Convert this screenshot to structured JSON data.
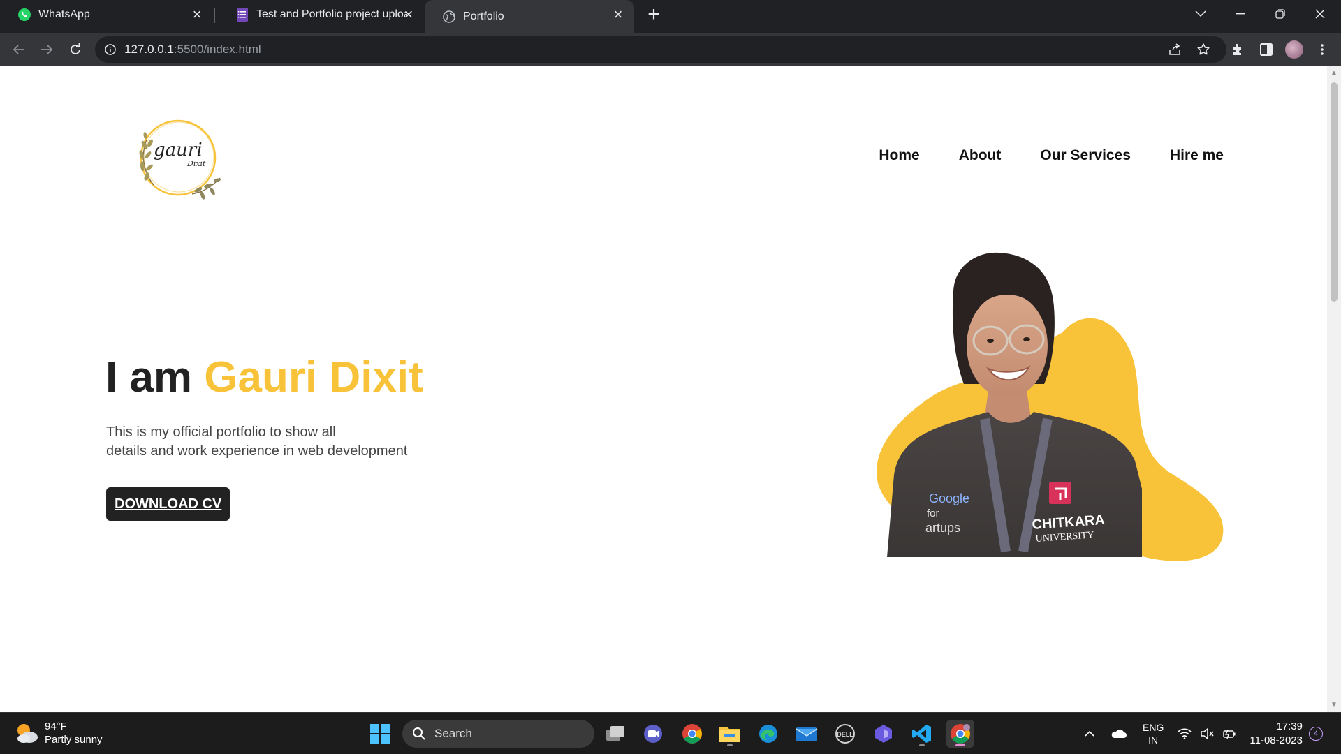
{
  "browser": {
    "tabs": [
      {
        "title": "WhatsApp",
        "icon": "whatsapp-icon"
      },
      {
        "title": "Test and Portfolio project upload",
        "icon": "forms-icon"
      },
      {
        "title": "Portfolio",
        "icon": "globe-icon"
      }
    ],
    "active_tab": 2,
    "url_host": "127.0.0.1",
    "url_path": ":5500/index.html"
  },
  "page": {
    "logo": {
      "line1": "gauri",
      "line2": "Dixit"
    },
    "nav": [
      "Home",
      "About",
      "Our Services",
      "Hire me"
    ],
    "hero": {
      "prefix": "I am",
      "name": "Gauri Dixit",
      "desc_line1": "This is my official portfolio to show all",
      "desc_line2": "details and work experience in web development",
      "cta": "DOWNLOAD CV"
    },
    "photo_text": {
      "brand": "CHITKARA",
      "sub": "UNIVERSITY",
      "shirt1": "Google",
      "shirt2": "for",
      "shirt3": "artups"
    },
    "accent_color": "#f8c239"
  },
  "taskbar": {
    "weather_temp": "94°F",
    "weather_desc": "Partly sunny",
    "search_label": "Search",
    "lang_line1": "ENG",
    "lang_line2": "IN",
    "time": "17:39",
    "date": "11-08-2023",
    "notification_count": "4"
  }
}
